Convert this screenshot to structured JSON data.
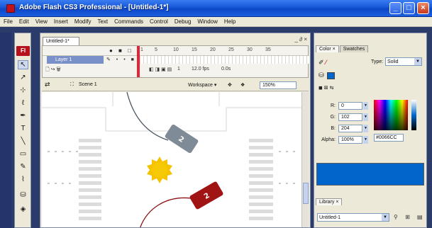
{
  "window": {
    "title": "Adobe Flash CS3 Professional - [Untitled-1*]",
    "minimize": "_",
    "maximize": "□",
    "close": "×"
  },
  "menu": [
    "File",
    "Edit",
    "View",
    "Insert",
    "Modify",
    "Text",
    "Commands",
    "Control",
    "Debug",
    "Window",
    "Help"
  ],
  "tools": {
    "badge": "Fl",
    "items": [
      {
        "name": "selection-tool-icon",
        "glyph": "↖"
      },
      {
        "name": "subselection-tool-icon",
        "glyph": "↗"
      },
      {
        "name": "free-transform-tool-icon",
        "glyph": "⊹"
      },
      {
        "name": "lasso-tool-icon",
        "glyph": "ℓ"
      },
      {
        "name": "pen-tool-icon",
        "glyph": "✒"
      },
      {
        "name": "text-tool-icon",
        "glyph": "T"
      },
      {
        "name": "line-tool-icon",
        "glyph": "╲"
      },
      {
        "name": "rectangle-tool-icon",
        "glyph": "▭"
      },
      {
        "name": "pencil-tool-icon",
        "glyph": "✎"
      },
      {
        "name": "brush-tool-icon",
        "glyph": "⌇"
      },
      {
        "name": "paint-bucket-tool-icon",
        "glyph": "⛁"
      },
      {
        "name": "eraser-tool-icon",
        "glyph": "◈"
      }
    ]
  },
  "document": {
    "tab": "Untitled-1*",
    "panel_controls": "_ ∂ ×",
    "timeline": {
      "frame_numbers": [
        "1",
        "5",
        "10",
        "15",
        "20",
        "25",
        "30",
        "35"
      ],
      "layer_name": "Layer 1",
      "fps": "12.0 fps",
      "time": "0.0s",
      "current_frame": "1"
    },
    "editbar": {
      "scene": "Scene 1",
      "workspace": "Workspace ▾",
      "zoom": "150%"
    }
  },
  "stage": {
    "shape_top_label": "2",
    "shape_bottom_label": "2",
    "colors": {
      "gray_shape": "#7f8b96",
      "red_shape": "#a01414",
      "sun": "#f5c200",
      "gray_line": "#4a5560",
      "red_line": "#8b1010"
    }
  },
  "color_panel": {
    "tabs": [
      "Color ×",
      "Swatches"
    ],
    "type_label": "Type:",
    "type_value": "Solid",
    "fields": [
      {
        "label": "R:",
        "value": "0"
      },
      {
        "label": "G:",
        "value": "102"
      },
      {
        "label": "B:",
        "value": "204"
      },
      {
        "label": "Alpha:",
        "value": "100%"
      }
    ],
    "hex": "#0066CC",
    "preview_color": "#0066cc"
  },
  "library_panel": {
    "tabs": [
      "Library ×"
    ],
    "document": "Untitled-1"
  }
}
